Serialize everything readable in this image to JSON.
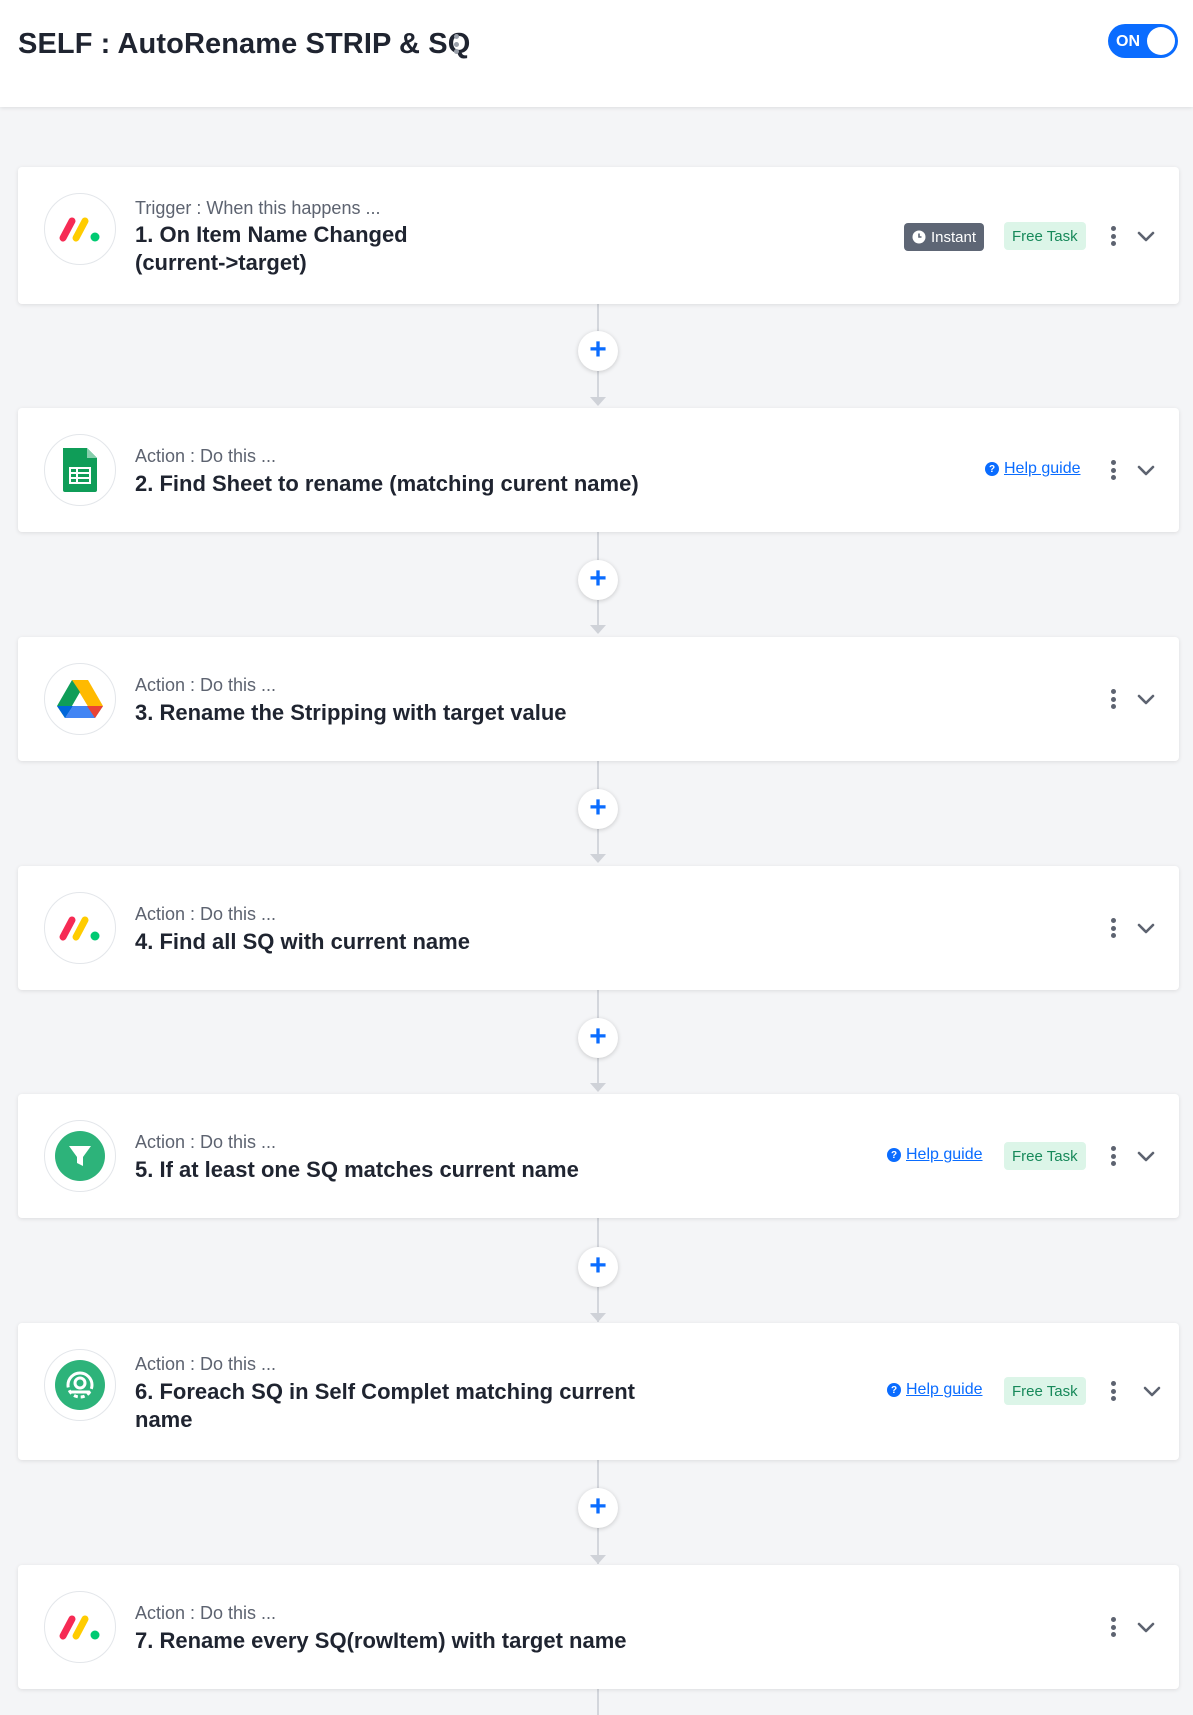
{
  "header": {
    "title": "SELF : AutoRename STRIP & SQ",
    "toggle_label": "ON"
  },
  "icons": {
    "menu": "kebab-vertical-icon",
    "expand": "chevron-down-icon",
    "add": "plus-icon",
    "help": "question-circle-icon",
    "instant": "clock-icon"
  },
  "colors": {
    "accent": "#0a6cff",
    "free_task_bg": "#dcf5e8",
    "free_task_text": "#17895a",
    "instant_bg": "#5e6675"
  },
  "steps": [
    {
      "app": "monday-logo-icon",
      "subtitle": "Trigger : When this happens ...",
      "title_lines": [
        "1. On Item Name Changed",
        "(current->target)"
      ],
      "instant_label": "Instant",
      "free_task_label": "Free Task"
    },
    {
      "app": "google-sheets-icon",
      "subtitle": "Action : Do this ...",
      "title_lines": [
        "2. Find Sheet to rename (matching curent name)"
      ],
      "help_label": "Help guide"
    },
    {
      "app": "google-drive-icon",
      "subtitle": "Action : Do this ...",
      "title_lines": [
        "3. Rename the Stripping with target value"
      ]
    },
    {
      "app": "monday-logo-icon",
      "subtitle": "Action : Do this ...",
      "title_lines": [
        "4. Find all SQ with current name"
      ]
    },
    {
      "app": "filter-icon",
      "subtitle": "Action : Do this ...",
      "title_lines": [
        "5. If at least one SQ matches current name"
      ],
      "help_label": "Help guide",
      "free_task_label": "Free Task"
    },
    {
      "app": "iterator-icon",
      "subtitle": "Action : Do this ...",
      "title_lines": [
        "6. Foreach SQ in Self Complet matching current",
        "name"
      ],
      "help_label": "Help guide",
      "free_task_label": "Free Task"
    },
    {
      "app": "monday-logo-icon",
      "subtitle": "Action : Do this ...",
      "title_lines": [
        "7. Rename every SQ(rowItem) with target name"
      ]
    }
  ]
}
